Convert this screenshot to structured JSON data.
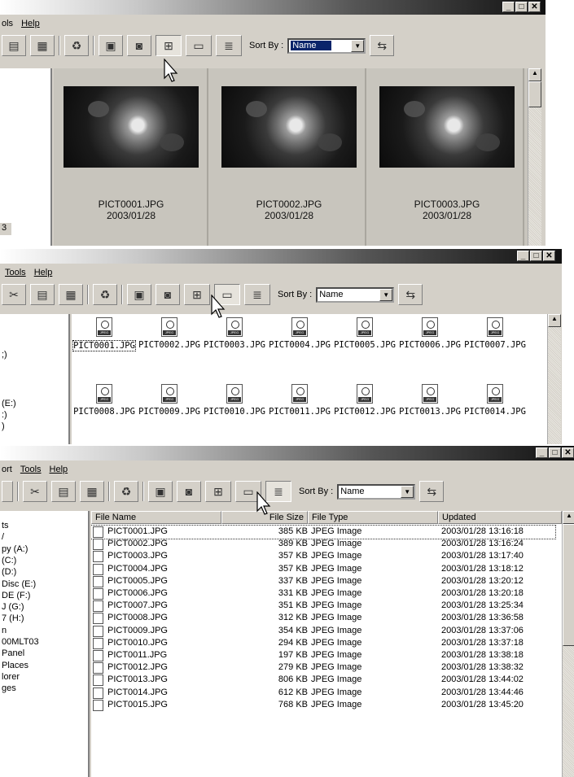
{
  "win1": {
    "caps": [
      "_",
      "□",
      "✕"
    ],
    "menu": [
      "ols",
      "Help"
    ],
    "sort_label": "Sort By :",
    "sort_value": "Name",
    "tree_items": [
      "3"
    ],
    "thumbnails": [
      {
        "name": "PICT0001.JPG",
        "date": "2003/01/28"
      },
      {
        "name": "PICT0002.JPG",
        "date": "2003/01/28"
      },
      {
        "name": "PICT0003.JPG",
        "date": "2003/01/28"
      }
    ]
  },
  "win2": {
    "caps": [
      "_",
      "□",
      "✕"
    ],
    "menu": [
      "Tools",
      "Help"
    ],
    "sort_label": "Sort By :",
    "sort_value": "Name",
    "tree_items": [
      ";)",
      "(E:)",
      ":)",
      ")"
    ],
    "icons_row1": [
      "PICT0001.JPG",
      "PICT0002.JPG",
      "PICT0003.JPG",
      "PICT0004.JPG",
      "PICT0005.JPG",
      "PICT0006.JPG",
      "PICT0007.JPG"
    ],
    "icons_row2": [
      "PICT0008.JPG",
      "PICT0009.JPG",
      "PICT0010.JPG",
      "PICT0011.JPG",
      "PICT0012.JPG",
      "PICT0013.JPG",
      "PICT0014.JPG"
    ]
  },
  "win3": {
    "caps": [
      "_",
      "□",
      "✕"
    ],
    "menu": [
      "ort",
      "Tools",
      "Help"
    ],
    "sort_label": "Sort By :",
    "sort_value": "Name",
    "tree_items": [
      "ts",
      "/",
      "py (A:)",
      "(C:)",
      "(D:)",
      "Disc (E:)",
      "DE (F:)",
      "J (G:)",
      "7 (H:)",
      "n",
      "00MLT03",
      "Panel",
      "Places",
      "lorer",
      "ges"
    ],
    "columns": [
      "File Name",
      "File Size",
      "File Type",
      "Updated"
    ],
    "rows": [
      [
        "PICT0001.JPG",
        "385 KB",
        "JPEG Image",
        "2003/01/28 13:16:18"
      ],
      [
        "PICT0002.JPG",
        "389 KB",
        "JPEG Image",
        "2003/01/28 13:16:24"
      ],
      [
        "PICT0003.JPG",
        "357 KB",
        "JPEG Image",
        "2003/01/28 13:17:40"
      ],
      [
        "PICT0004.JPG",
        "357 KB",
        "JPEG Image",
        "2003/01/28 13:18:12"
      ],
      [
        "PICT0005.JPG",
        "337 KB",
        "JPEG Image",
        "2003/01/28 13:20:12"
      ],
      [
        "PICT0006.JPG",
        "331 KB",
        "JPEG Image",
        "2003/01/28 13:20:18"
      ],
      [
        "PICT0007.JPG",
        "351 KB",
        "JPEG Image",
        "2003/01/28 13:25:34"
      ],
      [
        "PICT0008.JPG",
        "312 KB",
        "JPEG Image",
        "2003/01/28 13:36:58"
      ],
      [
        "PICT0009.JPG",
        "354 KB",
        "JPEG Image",
        "2003/01/28 13:37:06"
      ],
      [
        "PICT0010.JPG",
        "294 KB",
        "JPEG Image",
        "2003/01/28 13:37:18"
      ],
      [
        "PICT0011.JPG",
        "197 KB",
        "JPEG Image",
        "2003/01/28 13:38:18"
      ],
      [
        "PICT0012.JPG",
        "279 KB",
        "JPEG Image",
        "2003/01/28 13:38:32"
      ],
      [
        "PICT0013.JPG",
        "806 KB",
        "JPEG Image",
        "2003/01/28 13:44:02"
      ],
      [
        "PICT0014.JPG",
        "612 KB",
        "JPEG Image",
        "2003/01/28 13:44:46"
      ],
      [
        "PICT0015.JPG",
        "768 KB",
        "JPEG Image",
        "2003/01/28 13:45:20"
      ]
    ]
  }
}
